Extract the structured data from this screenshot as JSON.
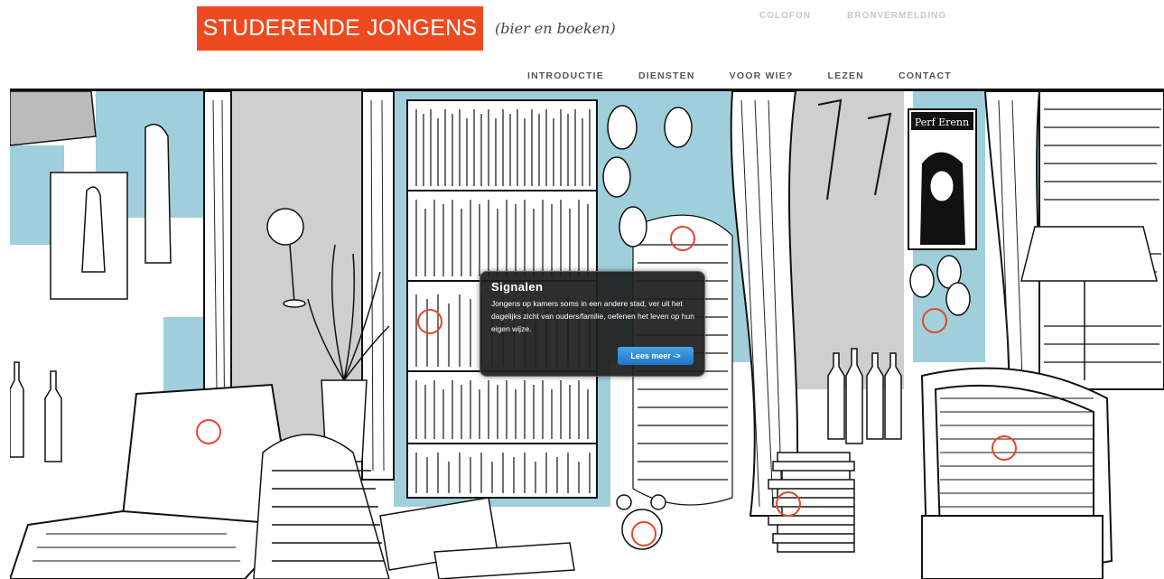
{
  "header": {
    "logo_text": "STUDERENDE JONGENS",
    "tagline": "(bier en boeken)",
    "brand_color": "#ef4a1f"
  },
  "top_nav": [
    "COLOFON",
    "BRONVERMELDING"
  ],
  "main_nav": [
    "INTRODUCTIE",
    "DIENSTEN",
    "VOOR WIE?",
    "LEZEN",
    "CONTACT"
  ],
  "popup": {
    "title": "Signalen",
    "body": "Jongens op kamers soms in een andere stad, ver uit het dagelijks zicht van ouders/familie, oefenen het leven op hun eigen wijze.",
    "button_label": "Lees meer ->"
  },
  "scene": {
    "accent_blue": "#9fcfdb",
    "poster_text": "Perf Erenn",
    "hotspot_color": "#e2472a"
  }
}
